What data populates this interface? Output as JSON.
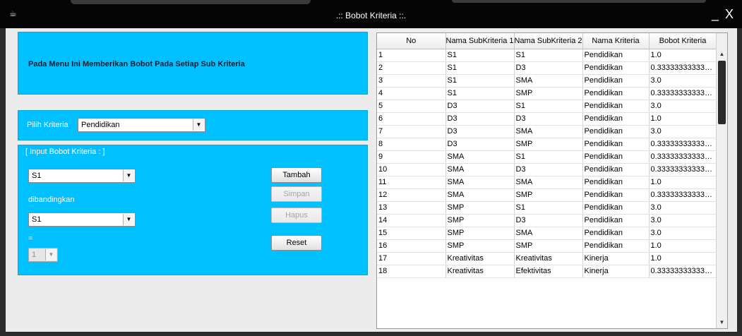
{
  "window": {
    "title": ".:: Bobot Kriteria ::.",
    "app_icon": "☕",
    "controls": "_ X"
  },
  "header": {
    "text": "Pada Menu Ini Memberikan Bobot  Pada Setiap Sub Kriteria"
  },
  "kriteria": {
    "label": "Pilih Kriteria",
    "selected": "Pendidikan"
  },
  "input_group": {
    "title": "[ Input Bobot Kriteria : ]",
    "sub1": "S1",
    "compare_label": "dibandingkan",
    "sub2": "S1",
    "equals": "=",
    "weight": "1"
  },
  "buttons": {
    "tambah": "Tambah",
    "simpan": "Simpan",
    "hapus": "Hapus",
    "reset": "Reset"
  },
  "table": {
    "columns": [
      "No",
      "Nama SubKriteria 1",
      "Nama SubKriteria 2",
      "Nama Kriteria",
      "Bobot Kriteria"
    ],
    "rows": [
      [
        "1",
        "S1",
        "S1",
        "Pendidikan",
        "1.0"
      ],
      [
        "2",
        "S1",
        "D3",
        "Pendidikan",
        "0.3333333333333..."
      ],
      [
        "3",
        "S1",
        "SMA",
        "Pendidikan",
        "3.0"
      ],
      [
        "4",
        "S1",
        "SMP",
        "Pendidikan",
        "0.3333333333333..."
      ],
      [
        "5",
        "D3",
        "S1",
        "Pendidikan",
        "3.0"
      ],
      [
        "6",
        "D3",
        "D3",
        "Pendidikan",
        "1.0"
      ],
      [
        "7",
        "D3",
        "SMA",
        "Pendidikan",
        "3.0"
      ],
      [
        "8",
        "D3",
        "SMP",
        "Pendidikan",
        "0.3333333333333..."
      ],
      [
        "9",
        "SMA",
        "S1",
        "Pendidikan",
        "0.3333333333333..."
      ],
      [
        "10",
        "SMA",
        "D3",
        "Pendidikan",
        "0.3333333333333..."
      ],
      [
        "11",
        "SMA",
        "SMA",
        "Pendidikan",
        "1.0"
      ],
      [
        "12",
        "SMA",
        "SMP",
        "Pendidikan",
        "0.3333333333333..."
      ],
      [
        "13",
        "SMP",
        "S1",
        "Pendidikan",
        "3.0"
      ],
      [
        "14",
        "SMP",
        "D3",
        "Pendidikan",
        "3.0"
      ],
      [
        "15",
        "SMP",
        "SMA",
        "Pendidikan",
        "3.0"
      ],
      [
        "16",
        "SMP",
        "SMP",
        "Pendidikan",
        "1.0"
      ],
      [
        "17",
        "Kreativitas",
        "Kreativitas",
        "Kinerja",
        "1.0"
      ],
      [
        "18",
        "Kreativitas",
        "Efektivitas",
        "Kinerja",
        "0.3333333333333..."
      ]
    ]
  },
  "icons": {
    "dropdown": "▼",
    "scroll_up": "▲",
    "scroll_down": "▼"
  }
}
